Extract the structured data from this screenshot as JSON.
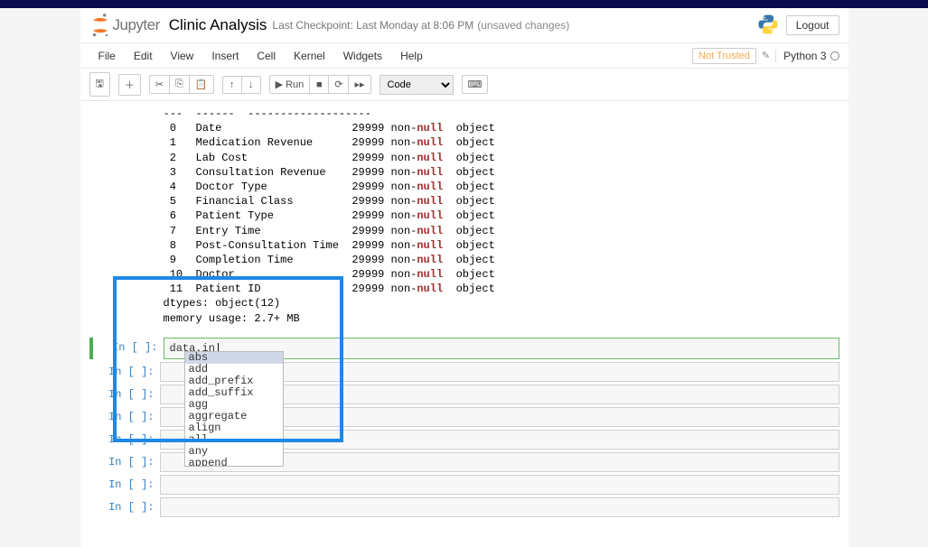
{
  "header": {
    "logo_text": "Jupyter",
    "title": "Clinic Analysis",
    "checkpoint": "Last Checkpoint: Last Monday at 8:06 PM",
    "unsaved": "(unsaved changes)",
    "logout": "Logout"
  },
  "menubar": {
    "items": [
      "File",
      "Edit",
      "View",
      "Insert",
      "Cell",
      "Kernel",
      "Widgets",
      "Help"
    ],
    "not_trusted": "Not Trusted",
    "kernel": "Python 3"
  },
  "toolbar": {
    "run": "Run",
    "celltype": "Code"
  },
  "output": {
    "rows": [
      {
        "idx": "---",
        "col": "------",
        "count": "--------------",
        "dtype": "-----"
      },
      {
        "idx": " 0 ",
        "col": "Date                  ",
        "count": "29999 non-null",
        "dtype": "  object"
      },
      {
        "idx": " 1 ",
        "col": "Medication Revenue    ",
        "count": "29999 non-null",
        "dtype": "  object"
      },
      {
        "idx": " 2 ",
        "col": "Lab Cost              ",
        "count": "29999 non-null",
        "dtype": "  object"
      },
      {
        "idx": " 3 ",
        "col": "Consultation Revenue  ",
        "count": "29999 non-null",
        "dtype": "  object"
      },
      {
        "idx": " 4 ",
        "col": "Doctor Type           ",
        "count": "29999 non-null",
        "dtype": "  object"
      },
      {
        "idx": " 5 ",
        "col": "Financial Class       ",
        "count": "29999 non-null",
        "dtype": "  object"
      },
      {
        "idx": " 6 ",
        "col": "Patient Type          ",
        "count": "29999 non-null",
        "dtype": "  object"
      },
      {
        "idx": " 7 ",
        "col": "Entry Time            ",
        "count": "29999 non-null",
        "dtype": "  object"
      },
      {
        "idx": " 8 ",
        "col": "Post-Consultation Time",
        "count": "29999 non-null",
        "dtype": "  object"
      },
      {
        "idx": " 9 ",
        "col": "Completion Time       ",
        "count": "29999 non-null",
        "dtype": "  object"
      },
      {
        "idx": " 10",
        "col": "Doctor                ",
        "count": "29999 non-null",
        "dtype": "  object"
      },
      {
        "idx": " 11",
        "col": "Patient ID            ",
        "count": "29999 non-null",
        "dtype": "  object"
      }
    ],
    "dtypes": "dtypes: object(12)",
    "memory": "memory usage: 2.7+ MB"
  },
  "active_cell": {
    "prompt": "In [ ]:",
    "code": "data.in",
    "caret": "|"
  },
  "autocomplete": {
    "items": [
      "abs",
      "add",
      "add_prefix",
      "add_suffix",
      "agg",
      "aggregate",
      "align",
      "all",
      "any",
      "append"
    ],
    "selected_index": 0
  },
  "empty_cells": {
    "prompt": "In [ ]:",
    "count": 7
  }
}
